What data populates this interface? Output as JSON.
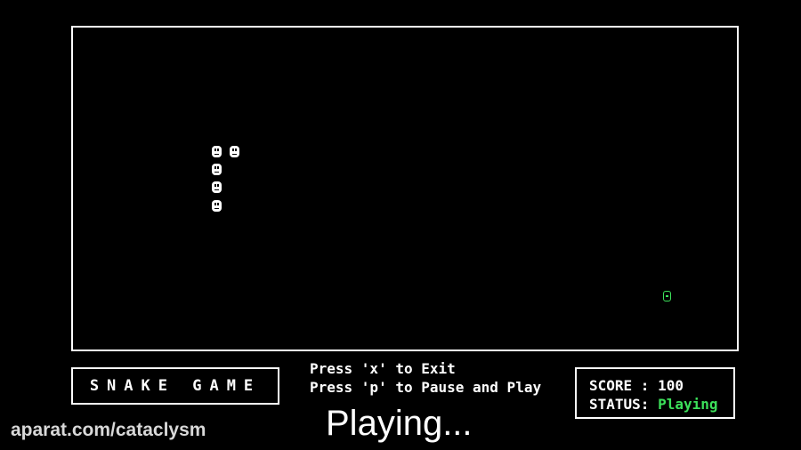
{
  "game": {
    "title": "SNAKE GAME",
    "instructions": {
      "exit": "Press 'x' to Exit",
      "pause": "Press 'p' to Pause and Play"
    },
    "score_label": "SCORE : ",
    "score_value": "100",
    "status_label": "STATUS: ",
    "status_value": "Playing",
    "status_color": "#3ce05a",
    "snake_color": "#ffffff",
    "food_color": "#3ce05a"
  },
  "overlay": {
    "status_caption": "Playing..."
  },
  "watermark": {
    "text": "aparat.com/cataclysm"
  }
}
